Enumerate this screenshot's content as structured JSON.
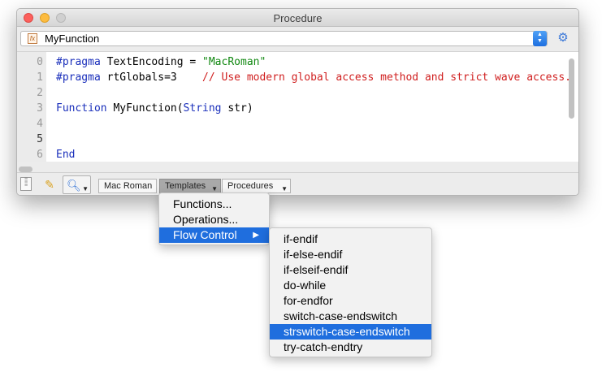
{
  "window": {
    "title": "Procedure"
  },
  "function_selector": {
    "icon": "fx-icon",
    "selected": "MyFunction"
  },
  "editor": {
    "lines": [
      {
        "num": "0",
        "parts": [
          {
            "t": "#pragma",
            "c": "kw"
          },
          {
            "t": " TextEncoding = ",
            "c": "plain"
          },
          {
            "t": "\"MacRoman\"",
            "c": "str"
          }
        ]
      },
      {
        "num": "1",
        "parts": [
          {
            "t": "#pragma",
            "c": "kw"
          },
          {
            "t": " rtGlobals=3    ",
            "c": "plain"
          },
          {
            "t": "// Use modern global access method and strict wave access.",
            "c": "cmt"
          }
        ]
      },
      {
        "num": "2",
        "parts": []
      },
      {
        "num": "3",
        "parts": [
          {
            "t": "Function",
            "c": "kw"
          },
          {
            "t": " MyFunction(",
            "c": "plain"
          },
          {
            "t": "String",
            "c": "kw"
          },
          {
            "t": " str)",
            "c": "plain"
          }
        ]
      },
      {
        "num": "4",
        "parts": []
      },
      {
        "num": "5",
        "parts": []
      },
      {
        "num": "6",
        "parts": [
          {
            "t": "End",
            "c": "kw"
          }
        ]
      }
    ],
    "current_line": "5"
  },
  "toolbar": {
    "encoding_label": "Mac Roman",
    "templates_label": "Templates",
    "procedures_label": "Procedures"
  },
  "templates_menu": {
    "items": [
      "Functions...",
      "Operations...",
      "Flow Control"
    ],
    "active": "Flow Control"
  },
  "flow_control_menu": {
    "items": [
      "if-endif",
      "if-else-endif",
      "if-elseif-endif",
      "do-while",
      "for-endfor",
      "switch-case-endswitch",
      "strswitch-case-endswitch",
      "try-catch-endtry"
    ],
    "active": "strswitch-case-endswitch"
  },
  "colors": {
    "keyword": "#1a2fbb",
    "string": "#118811",
    "comment": "#d01f1f",
    "selection": "#1f6ede"
  }
}
